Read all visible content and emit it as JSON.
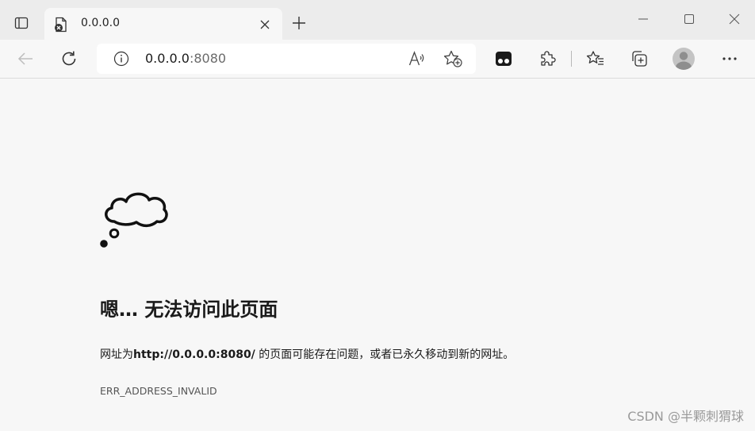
{
  "tab": {
    "title": "0.0.0.0",
    "favicon": "page-error-icon"
  },
  "toolbar": {
    "address_host": "0.0.0.0",
    "address_port": ":8080"
  },
  "content": {
    "title": "嗯… 无法访问此页面",
    "desc_prefix": "网址为",
    "desc_url": "http://0.0.0.0:8080/",
    "desc_suffix": " 的页面可能存在问题，或者已永久移动到新的网址。",
    "error_code": "ERR_ADDRESS_INVALID"
  },
  "watermark": "CSDN @半颗刺猬球",
  "icons": [
    "tab-actions-icon",
    "page-error-icon",
    "close-icon",
    "plus-icon",
    "minimize-icon",
    "maximize-icon",
    "window-close-icon",
    "back-arrow-icon",
    "refresh-icon",
    "info-icon",
    "read-aloud-icon",
    "add-favorite-icon",
    "extension-app-icon",
    "extensions-puzzle-icon",
    "favorites-icon",
    "collections-icon",
    "profile-avatar-icon",
    "more-menu-icon",
    "thought-cloud-icon"
  ],
  "colors": {
    "tabstrip_bg": "#ececec",
    "page_bg": "#f7f7f7",
    "text": "#1a1a1a",
    "muted": "#555555"
  }
}
